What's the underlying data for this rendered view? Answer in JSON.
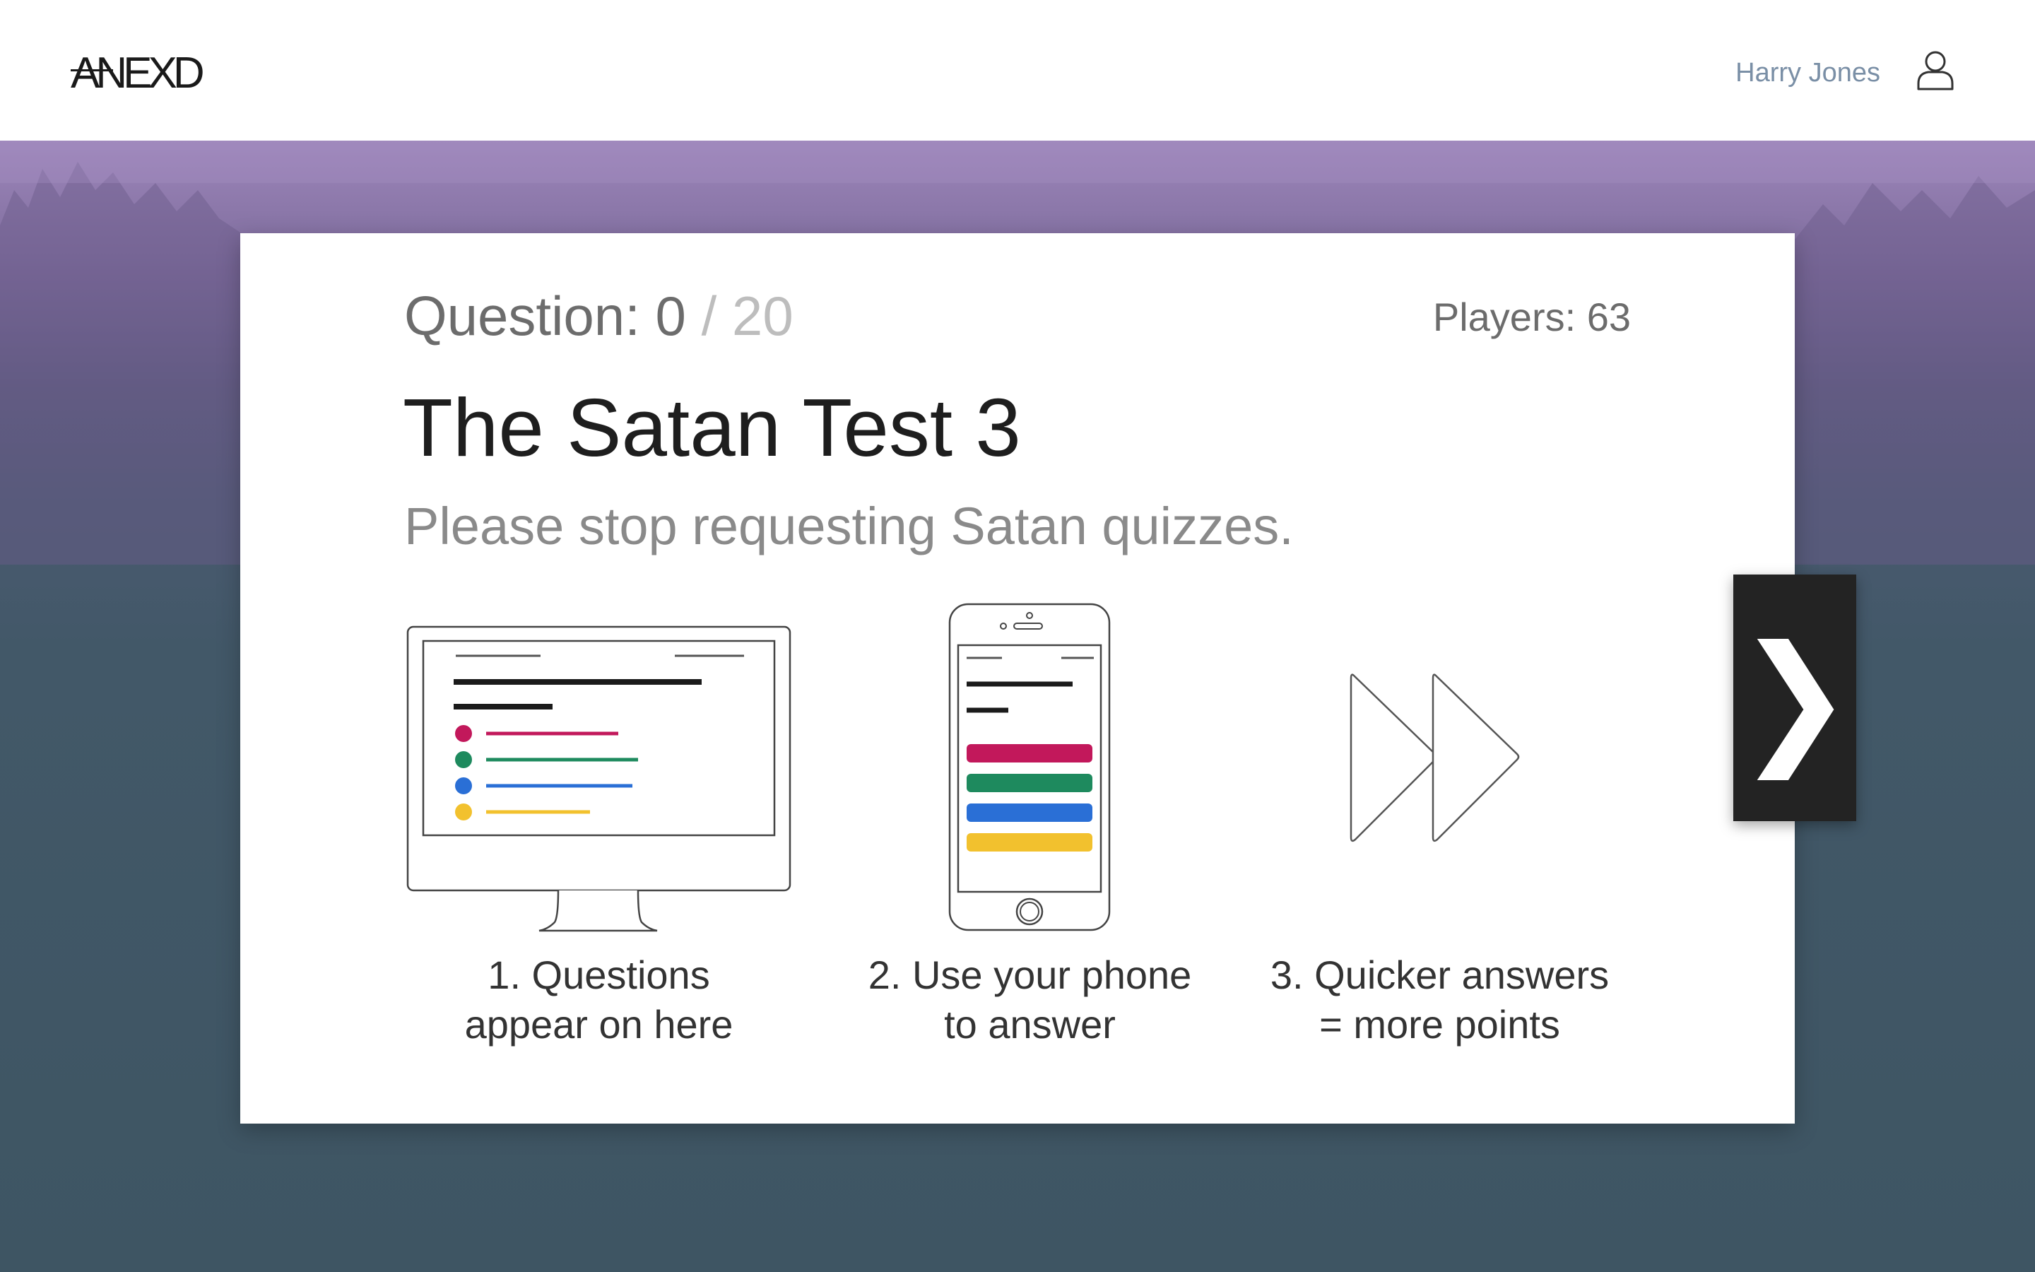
{
  "header": {
    "logo": "ANEXD",
    "user_name": "Harry Jones",
    "user_icon": "user-icon"
  },
  "quiz": {
    "question_label": "Question: 0",
    "question_total": "/ 20",
    "players": "Players: 63",
    "title": "The Satan Test 3",
    "subtitle": "Please stop requesting Satan quizzes."
  },
  "steps": [
    {
      "icon": "monitor-icon",
      "line1": "1. Questions",
      "line2": "appear on here"
    },
    {
      "icon": "phone-icon",
      "line1": "2. Use your phone",
      "line2": "to answer"
    },
    {
      "icon": "fast-forward-icon",
      "line1": "3. Quicker answers",
      "line2": "= more points"
    }
  ],
  "next_button": {
    "icon": "chevron-right-icon",
    "label": "❯"
  },
  "colors": {
    "red": "#c2185b",
    "green": "#1e8a5e",
    "blue": "#2a6fd6",
    "yellow": "#f2c12e"
  }
}
